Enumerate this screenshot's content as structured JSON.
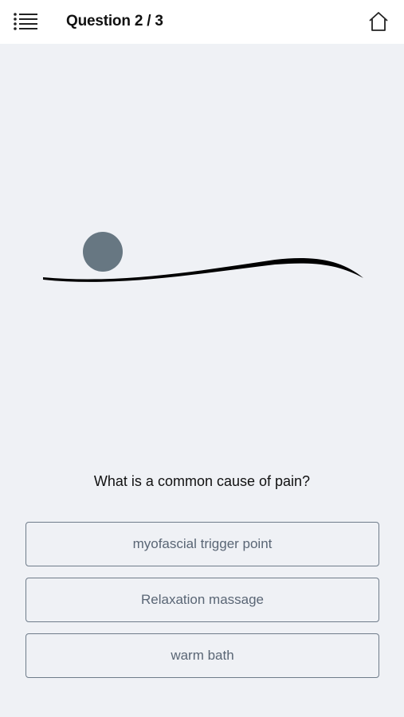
{
  "header": {
    "menu_icon": "menu-list-icon",
    "title": "Question 2 / 3",
    "home_icon": "home-icon"
  },
  "illustration": {
    "description_icon": "ball-on-curve-illustration",
    "ball_color": "#677782",
    "curve_color": "#000000"
  },
  "question": {
    "text": "What is a common cause of pain?"
  },
  "answers": [
    {
      "label": "myofascial trigger point"
    },
    {
      "label": "Relaxation massage"
    },
    {
      "label": "warm bath"
    }
  ],
  "colors": {
    "background": "#eff1f5",
    "header_bg": "#ffffff",
    "answer_border": "#6f7c8a",
    "answer_text": "#5a6675"
  }
}
